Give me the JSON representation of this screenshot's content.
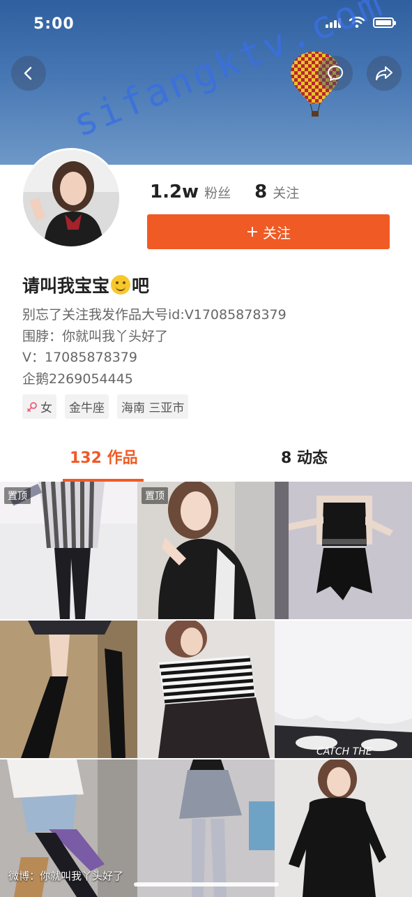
{
  "status_bar": {
    "time": "5:00"
  },
  "watermark": "sifangktv.com",
  "profile": {
    "fans_count": "1.2w",
    "fans_label": "粉丝",
    "following_count": "8",
    "following_label": "关注",
    "follow_button": "关注",
    "nickname_part1": "请叫我宝宝",
    "nickname_part2": "吧",
    "bio": [
      "别忘了关注我发作品大号id:V17085878379",
      "围脖：你就叫我丫头好了",
      "V：17085878379",
      "企鹅2269054445"
    ],
    "tags": [
      "女",
      "金牛座",
      "海南 三亚市"
    ]
  },
  "tabs": {
    "works": "132 作品",
    "feed": "8 动态"
  },
  "grid": {
    "pinned_label": "置顶",
    "caption_item7": "微博：你就叫我丫头好了"
  },
  "colors": {
    "accent": "#f05a24",
    "banner_top": "#2f5f9e",
    "banner_bottom": "#6e98c7"
  },
  "icons": [
    "back-icon",
    "chat-bubble-icon",
    "share-icon",
    "plus-icon",
    "female-icon",
    "wifi-icon",
    "battery-icon",
    "signal-icon"
  ]
}
